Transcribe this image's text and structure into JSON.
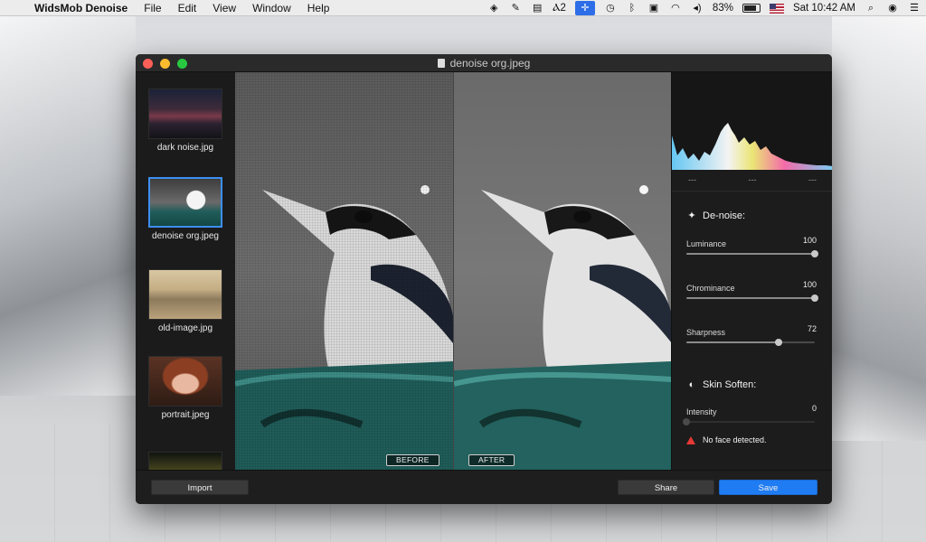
{
  "menubar": {
    "apple_glyph": "",
    "app_name": "WidsMob Denoise",
    "menus": [
      "File",
      "Edit",
      "View",
      "Window",
      "Help"
    ],
    "status": {
      "adobe_count": "2",
      "battery_percent": "83%",
      "clock": "Sat 10:42 AM"
    }
  },
  "window": {
    "title": "denoise org.jpeg"
  },
  "sidebar": {
    "thumbnails": [
      {
        "label": "dark noise.jpg",
        "selected": false
      },
      {
        "label": "denoise org.jpeg",
        "selected": true
      },
      {
        "label": "old-image.jpg",
        "selected": false
      },
      {
        "label": "portrait.jpeg",
        "selected": false
      },
      {
        "label": "",
        "selected": false
      }
    ]
  },
  "compare": {
    "before_label": "BEFORE",
    "after_label": "AFTER"
  },
  "panel": {
    "histogram_readouts": [
      "---",
      "---",
      "---"
    ],
    "denoise": {
      "title": "De-noise:",
      "sliders": [
        {
          "label": "Luminance",
          "value": 100,
          "max": 100
        },
        {
          "label": "Chrominance",
          "value": 100,
          "max": 100
        },
        {
          "label": "Sharpness",
          "value": 72,
          "max": 100
        }
      ]
    },
    "skin": {
      "title": "Skin Soften:",
      "intensity_label": "Intensity",
      "intensity_value": 0,
      "intensity_max": 100,
      "warning": "No face detected."
    }
  },
  "bottom": {
    "import_label": "Import",
    "share_label": "Share",
    "save_label": "Save"
  },
  "colors": {
    "accent": "#1f7cf2",
    "close": "#fc5f57",
    "minimize": "#fdbc2e",
    "maximize": "#28c840",
    "warning": "#e53935"
  }
}
